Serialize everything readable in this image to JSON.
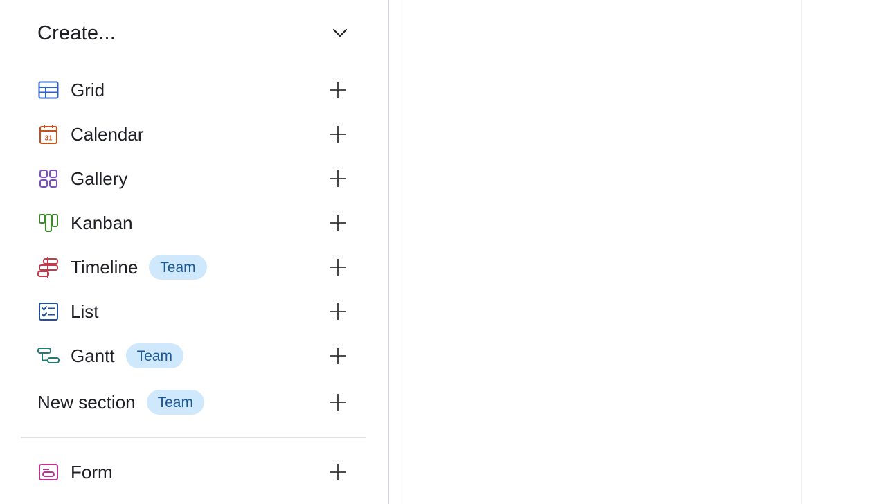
{
  "create_menu": {
    "title": "Create...",
    "collapse_icon": "chevron-down-icon"
  },
  "views": [
    {
      "label": "Grid",
      "icon": "grid-icon",
      "color": "#2d7ff9",
      "badge": ""
    },
    {
      "label": "Calendar",
      "icon": "calendar-icon",
      "color": "#d54401",
      "badge": ""
    },
    {
      "label": "Gallery",
      "icon": "gallery-icon",
      "color": "#7c39ed",
      "badge": ""
    },
    {
      "label": "Kanban",
      "icon": "kanban-icon",
      "color": "#338a17",
      "badge": ""
    },
    {
      "label": "Timeline",
      "icon": "timeline-icon",
      "color": "#dc043b",
      "badge": "Team"
    },
    {
      "label": "List",
      "icon": "list-icon",
      "color": "#0d52ac",
      "badge": ""
    },
    {
      "label": "Gantt",
      "icon": "gantt-icon",
      "color": "#0d7f78",
      "badge": "Team"
    }
  ],
  "new_section": {
    "label": "New section",
    "badge": "Team"
  },
  "form": {
    "label": "Form",
    "icon": "form-icon",
    "color": "#dd04a8"
  },
  "colors": {
    "badge_bg": "#cfe8fc",
    "badge_text": "#1b5a96",
    "text": "#1d1f25"
  }
}
